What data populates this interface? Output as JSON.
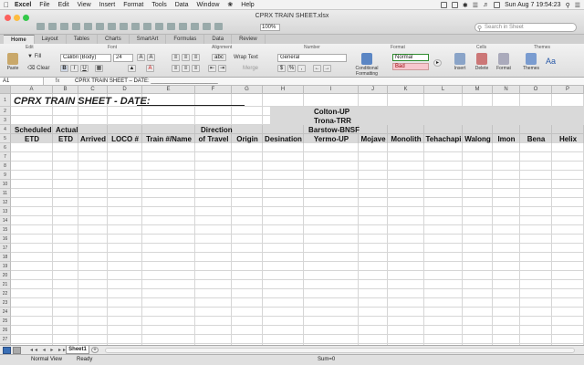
{
  "menubar": {
    "app_name": "Excel",
    "items": [
      "File",
      "Edit",
      "View",
      "Insert",
      "Format",
      "Tools",
      "Data",
      "Window",
      "Help"
    ],
    "clock": "Sun Aug 7  19:54:23"
  },
  "window": {
    "title": "CPRX TRAIN SHEET.xlsx",
    "zoom": "100%",
    "search_placeholder": "Search in Sheet"
  },
  "ribbon_tabs": [
    "Home",
    "Layout",
    "Tables",
    "Charts",
    "SmartArt",
    "Formulas",
    "Data",
    "Review"
  ],
  "ribbon": {
    "groups": {
      "edit": "Edit",
      "font": "Font",
      "alignment": "Alignment",
      "number": "Number",
      "format": "Format",
      "cells": "Cells",
      "themes": "Themes"
    },
    "paste_label": "Paste",
    "fill_label": "Fill",
    "clear_label": "Clear",
    "font_name": "Calibri (Body)",
    "font_size": "24",
    "bold": "B",
    "italic": "I",
    "underline": "U",
    "abc": "abc",
    "wrap_text": "Wrap Text",
    "merge": "Merge",
    "number_format": "General",
    "conditional_formatting": "Conditional Formatting",
    "style_normal": "Normal",
    "style_bad": "Bad",
    "insert": "Insert",
    "delete": "Delete",
    "format": "Format",
    "themes": "Themes",
    "aa": "Aa"
  },
  "formula_bar": {
    "cell_ref": "A1",
    "fx": "fx",
    "content": "CPRX TRAIN SHEET – DATE: ______________________"
  },
  "grid": {
    "columns": [
      "A",
      "B",
      "C",
      "D",
      "E",
      "F",
      "G",
      "H",
      "I",
      "J",
      "K",
      "L",
      "M",
      "N",
      "O",
      "P"
    ],
    "row_numbers": [
      "1",
      "2",
      "3",
      "4",
      "5",
      "6",
      "7",
      "8",
      "9",
      "10",
      "11",
      "12",
      "13",
      "14",
      "15",
      "16",
      "17",
      "18",
      "19",
      "20",
      "21",
      "22",
      "23",
      "24",
      "25",
      "26",
      "27",
      "28",
      "29"
    ],
    "title": "CPRX TRAIN SHEET - DATE:",
    "i2": "Colton-UP",
    "i3": "Trona-TRR",
    "i4": "Barstow-BNSF",
    "a4": "Scheduled",
    "b4": "Actual",
    "f4": "Direction",
    "headers": [
      "ETD",
      "ETD",
      "Arrived",
      "LOCO #",
      "Train #/Name",
      "of Travel",
      "Origin",
      "Desination",
      "Yermo-UP",
      "Mojave",
      "Monolith",
      "Tehachapi",
      "Walong",
      "Imon",
      "Bena",
      "Helix"
    ]
  },
  "sheet": {
    "nav": "◂◂ ◂ ▸ ▸▸",
    "tab": "Sheet1",
    "add": "+"
  },
  "status": {
    "view": "Normal View",
    "ready": "Ready",
    "sum": "Sum=0"
  }
}
